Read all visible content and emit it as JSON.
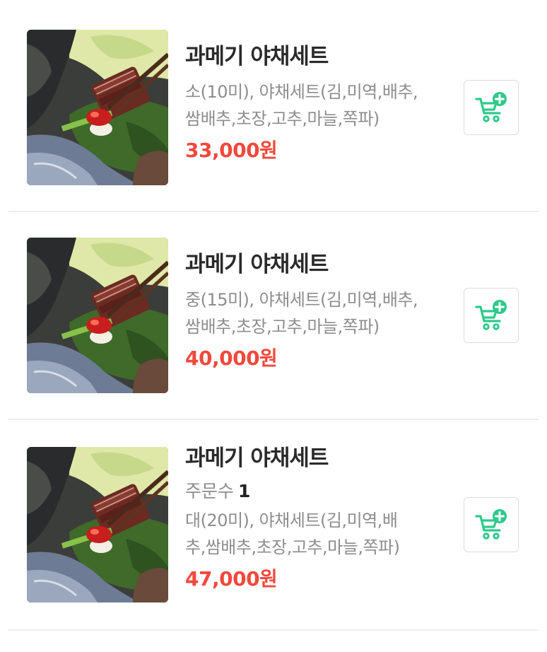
{
  "products": [
    {
      "title": "과메기 야채세트",
      "desc_line1": "소(10미), 야채세트(김,미역,배추,",
      "desc_line2": "쌈배추,초장,고추,마늘,쪽파)",
      "price": "33,000원",
      "image_icon": "gwamegi-photo",
      "cart_icon": "cart-plus-icon"
    },
    {
      "title": "과메기 야채세트",
      "desc_line1": "중(15미), 야채세트(김,미역,배추,",
      "desc_line2": "쌈배추,초장,고추,마늘,쪽파)",
      "price": "40,000원",
      "image_icon": "gwamegi-photo",
      "cart_icon": "cart-plus-icon"
    },
    {
      "title": "과메기 야채세트",
      "orders_label": "주문수",
      "orders_count": "1",
      "desc_line1": "대(20미), 야채세트(김,미역,배",
      "desc_line2": "추,쌈배추,초장,고추,마늘,쪽파)",
      "price": "47,000원",
      "image_icon": "gwamegi-photo",
      "cart_icon": "cart-plus-icon"
    }
  ],
  "colors": {
    "price": "#f0493c",
    "cart_accent": "#2ec98b",
    "divider": "#eeeeee"
  }
}
